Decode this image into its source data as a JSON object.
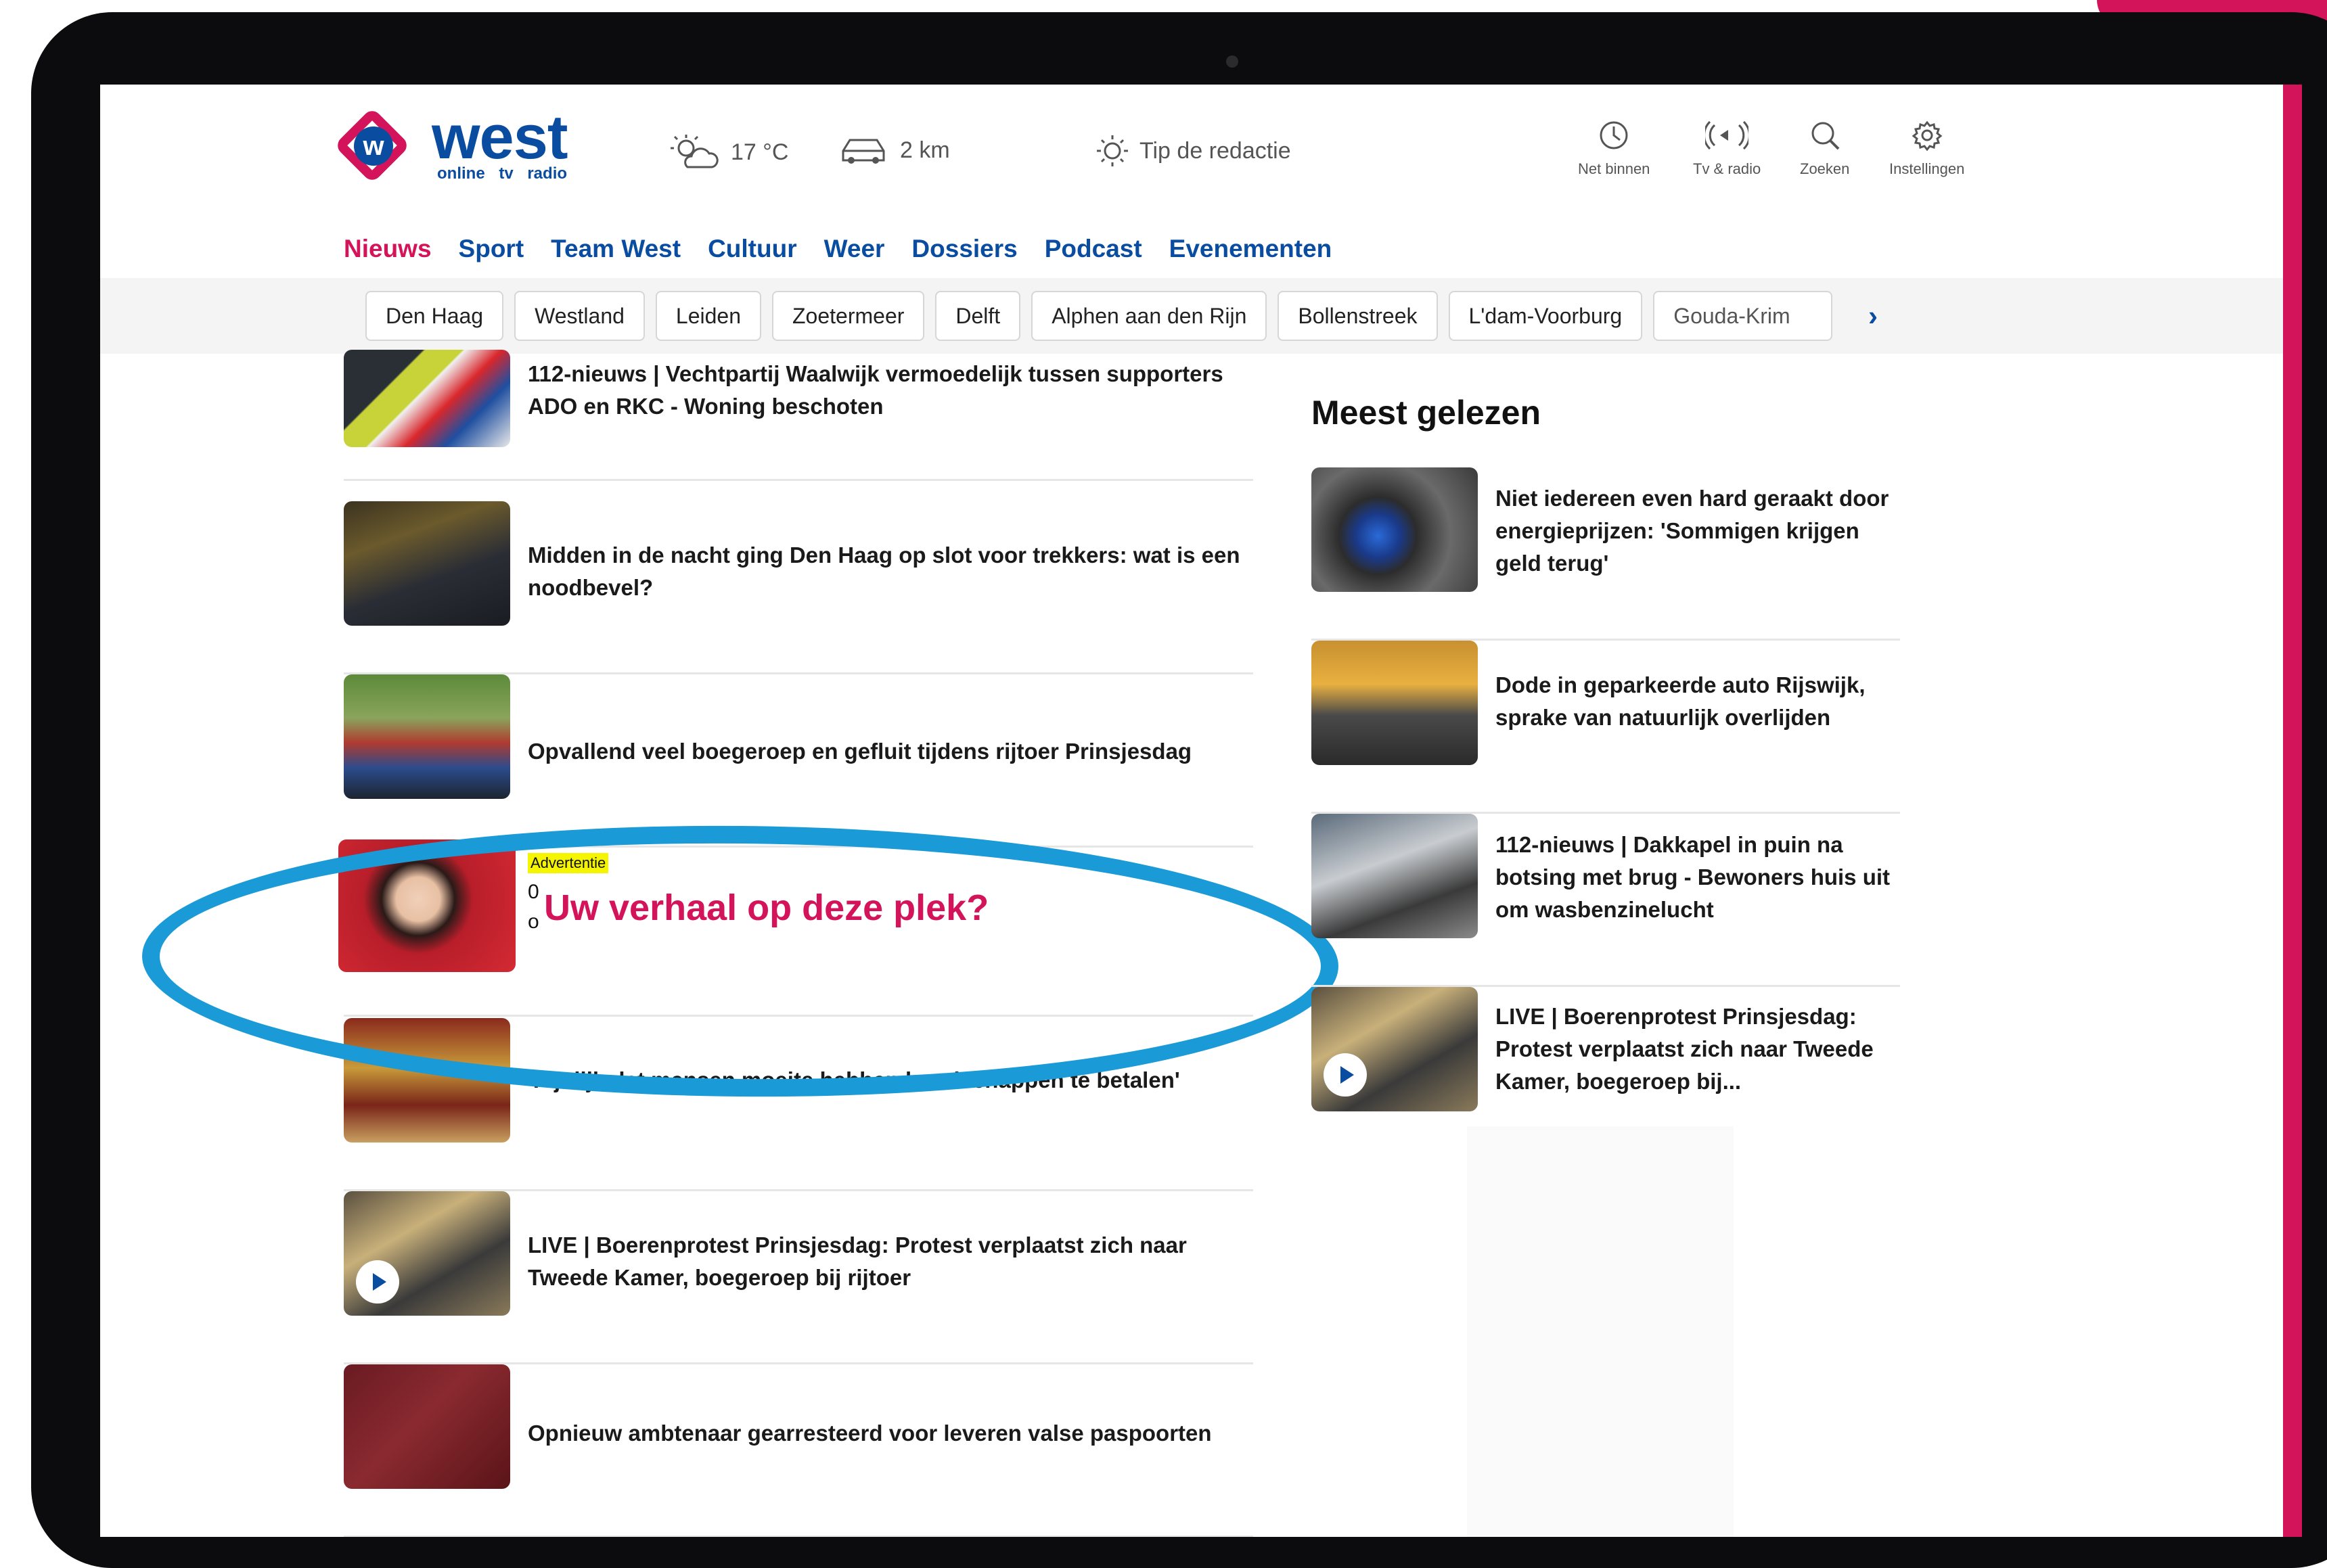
{
  "brand": {
    "logo_letter": "w",
    "name": "west",
    "tagline": "online  tv  radio",
    "accent_color": "#d4145a",
    "brand_color": "#0a4da0"
  },
  "header": {
    "weather": {
      "icon": "partly-cloudy-icon",
      "text": "17 °C"
    },
    "traffic": {
      "icon": "car-icon",
      "text": "2 km"
    },
    "tip": {
      "icon": "lightbulb-icon",
      "text": "Tip de redactie"
    },
    "tools": [
      {
        "icon": "clock-icon",
        "label": "Net binnen"
      },
      {
        "icon": "broadcast-icon",
        "label": "Tv & radio"
      },
      {
        "icon": "search-icon",
        "label": "Zoeken"
      },
      {
        "icon": "gear-icon",
        "label": "Instellingen"
      }
    ]
  },
  "nav": {
    "items": [
      "Nieuws",
      "Sport",
      "Team West",
      "Cultuur",
      "Weer",
      "Dossiers",
      "Podcast",
      "Evenementen"
    ],
    "active": "Nieuws"
  },
  "regions": {
    "chips": [
      "Den Haag",
      "Westland",
      "Leiden",
      "Zoetermeer",
      "Delft",
      "Alphen aan den Rijn",
      "Bollenstreek",
      "L'dam-Voorburg",
      "Gouda-Krim"
    ],
    "next_icon": "chevron-right-icon"
  },
  "news": [
    {
      "title": "112-nieuws | Vechtpartij Waalwijk vermoedelijk tussen supporters ADO en RKC - Woning beschoten"
    },
    {
      "title": "Midden in de nacht ging Den Haag op slot voor trekkers: wat is een noodbevel?"
    },
    {
      "title": "Opvallend veel boegeroep en gefluit tijdens rijtoer Prinsjesdag"
    },
    {
      "title": "'Pijnlijk dat mensen moeite hebben boodschappen te betalen'"
    },
    {
      "title": "LIVE | Boerenprotest Prinsjesdag: Protest verplaatst zich naar Tweede Kamer, boegeroep bij rijtoer"
    },
    {
      "title": "Opnieuw ambtenaar gearresteerd voor leveren valse paspoorten"
    }
  ],
  "advert": {
    "label": "Advertentie",
    "line1": "0",
    "line2": "o",
    "headline": "Uw verhaal op deze plek?"
  },
  "sidebar": {
    "title": "Meest gelezen",
    "items": [
      {
        "title": "Niet iedereen even hard geraakt door energieprijzen: 'Sommigen krijgen geld terug'"
      },
      {
        "title": "Dode in geparkeerde auto Rijswijk, sprake van natuurlijk overlijden"
      },
      {
        "title": "112-nieuws | Dakkapel in puin na botsing met brug - Bewoners huis uit om wasbenzinelucht"
      },
      {
        "title": "LIVE | Boerenprotest Prinsjesdag: Protest verplaatst zich naar Tweede Kamer, boegeroep bij..."
      }
    ]
  }
}
